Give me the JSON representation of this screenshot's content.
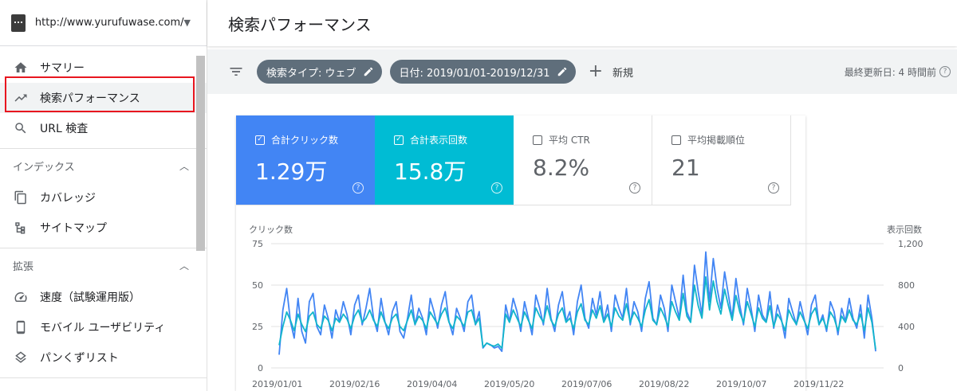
{
  "sidebar": {
    "property_url": "http://www.yurufuwase.com/",
    "items_top": [
      {
        "label": "サマリー",
        "icon": "home-icon"
      },
      {
        "label": "検索パフォーマンス",
        "icon": "trending-up-icon"
      },
      {
        "label": "URL 検査",
        "icon": "search-icon"
      }
    ],
    "section_index": {
      "title": "インデックス",
      "items": [
        {
          "label": "カバレッジ",
          "icon": "copy-icon"
        },
        {
          "label": "サイトマップ",
          "icon": "sitemap-icon"
        }
      ]
    },
    "section_ext": {
      "title": "拡張",
      "items": [
        {
          "label": "速度（試験運用版）",
          "icon": "speed-icon"
        },
        {
          "label": "モバイル ユーザビリティ",
          "icon": "phone-icon"
        },
        {
          "label": "パンくずリスト",
          "icon": "layers-icon"
        }
      ]
    }
  },
  "header": {
    "title": "検索パフォーマンス"
  },
  "filters": {
    "chip_search_type": "検索タイプ: ウェブ",
    "chip_date": "日付: 2019/01/01-2019/12/31",
    "new_label": "新規",
    "last_updated": "最終更新日: 4 時間前"
  },
  "metrics": [
    {
      "label": "合計クリック数",
      "value": "1.29万",
      "checked": true,
      "color": "#4285f4"
    },
    {
      "label": "合計表示回数",
      "value": "15.8万",
      "checked": true,
      "color": "#00bcd4"
    },
    {
      "label": "平均 CTR",
      "value": "8.2%",
      "checked": false
    },
    {
      "label": "平均掲載順位",
      "value": "21",
      "checked": false
    }
  ],
  "chart_data": {
    "type": "line",
    "ylabel_left": "クリック数",
    "ylabel_right": "表示回数",
    "left_ticks": [
      "75",
      "50",
      "25",
      "0"
    ],
    "right_ticks": [
      "1,200",
      "800",
      "400",
      "0"
    ],
    "x_ticks": [
      "2019/01/01",
      "2019/02/16",
      "2019/04/04",
      "2019/05/20",
      "2019/07/06",
      "2019/08/22",
      "2019/10/07",
      "2019/11/22"
    ],
    "ylim_left": [
      0,
      75
    ],
    "ylim_right": [
      0,
      1200
    ],
    "series": [
      {
        "name": "合計クリック数",
        "color": "#4285f4",
        "values": [
          8,
          35,
          48,
          28,
          18,
          42,
          22,
          15,
          40,
          45,
          25,
          20,
          38,
          30,
          18,
          35,
          28,
          40,
          32,
          20,
          38,
          44,
          26,
          36,
          48,
          30,
          22,
          42,
          28,
          20,
          34,
          40,
          22,
          18,
          30,
          44,
          26,
          36,
          30,
          20,
          42,
          34,
          24,
          38,
          46,
          28,
          20,
          36,
          30,
          22,
          40,
          44,
          26,
          34,
          12,
          15,
          14,
          12,
          13,
          10,
          38,
          28,
          42,
          34,
          22,
          40,
          30,
          20,
          44,
          36,
          26,
          48,
          30,
          22,
          38,
          46,
          28,
          34,
          20,
          40,
          50,
          30,
          24,
          42,
          32,
          46,
          28,
          38,
          22,
          44,
          36,
          30,
          48,
          26,
          40,
          34,
          22,
          42,
          52,
          30,
          26,
          44,
          36,
          22,
          50,
          40,
          30,
          56,
          34,
          28,
          62,
          46,
          32,
          70,
          40,
          66,
          48,
          36,
          58,
          44,
          30,
          54,
          38,
          26,
          48,
          36,
          22,
          44,
          32,
          28,
          46,
          24,
          38,
          30,
          18,
          42,
          34,
          26,
          40,
          30,
          20,
          38,
          44,
          26,
          32,
          22,
          40,
          34,
          20,
          36,
          28,
          42,
          30,
          24,
          38,
          18,
          44,
          30,
          10
        ]
      },
      {
        "name": "合計表示回数",
        "color": "#12b5cb",
        "values": [
          220,
          400,
          540,
          460,
          360,
          520,
          420,
          350,
          500,
          540,
          420,
          380,
          500,
          460,
          360,
          480,
          440,
          520,
          470,
          380,
          500,
          560,
          440,
          480,
          560,
          460,
          400,
          540,
          440,
          380,
          480,
          520,
          400,
          360,
          460,
          560,
          420,
          500,
          460,
          380,
          540,
          480,
          420,
          520,
          580,
          440,
          380,
          500,
          460,
          400,
          540,
          560,
          420,
          480,
          200,
          240,
          220,
          210,
          230,
          190,
          520,
          440,
          560,
          480,
          400,
          540,
          460,
          380,
          580,
          500,
          440,
          600,
          460,
          400,
          520,
          580,
          440,
          480,
          380,
          540,
          620,
          460,
          420,
          560,
          480,
          600,
          440,
          520,
          400,
          580,
          500,
          460,
          620,
          440,
          540,
          480,
          400,
          560,
          660,
          460,
          420,
          580,
          500,
          400,
          640,
          540,
          460,
          720,
          500,
          440,
          800,
          600,
          480,
          880,
          560,
          840,
          640,
          520,
          760,
          600,
          460,
          700,
          540,
          440,
          640,
          520,
          400,
          580,
          480,
          440,
          600,
          400,
          520,
          460,
          360,
          560,
          480,
          420,
          540,
          460,
          380,
          520,
          580,
          420,
          480,
          380,
          540,
          480,
          360,
          500,
          440,
          560,
          460,
          420,
          520,
          360,
          580,
          440,
          180
        ]
      }
    ]
  }
}
